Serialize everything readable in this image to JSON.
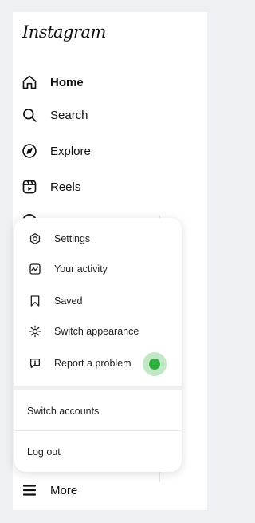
{
  "app": {
    "logo_text": "Instagram"
  },
  "nav": {
    "items": [
      {
        "label": "Home",
        "icon": "home-icon",
        "active": true
      },
      {
        "label": "Search",
        "icon": "search-icon"
      },
      {
        "label": "Explore",
        "icon": "compass-icon"
      },
      {
        "label": "Reels",
        "icon": "reels-icon"
      }
    ],
    "more_label": "More"
  },
  "more_menu": {
    "items": [
      {
        "label": "Settings",
        "icon": "gear-icon"
      },
      {
        "label": "Your activity",
        "icon": "activity-icon"
      },
      {
        "label": "Saved",
        "icon": "bookmark-icon"
      },
      {
        "label": "Switch appearance",
        "icon": "sun-icon"
      },
      {
        "label": "Report a problem",
        "icon": "report-icon"
      }
    ],
    "switch_accounts": "Switch accounts",
    "log_out": "Log out"
  },
  "colors": {
    "accent_cursor": "#2fae3f",
    "background": "#eef0f4"
  }
}
